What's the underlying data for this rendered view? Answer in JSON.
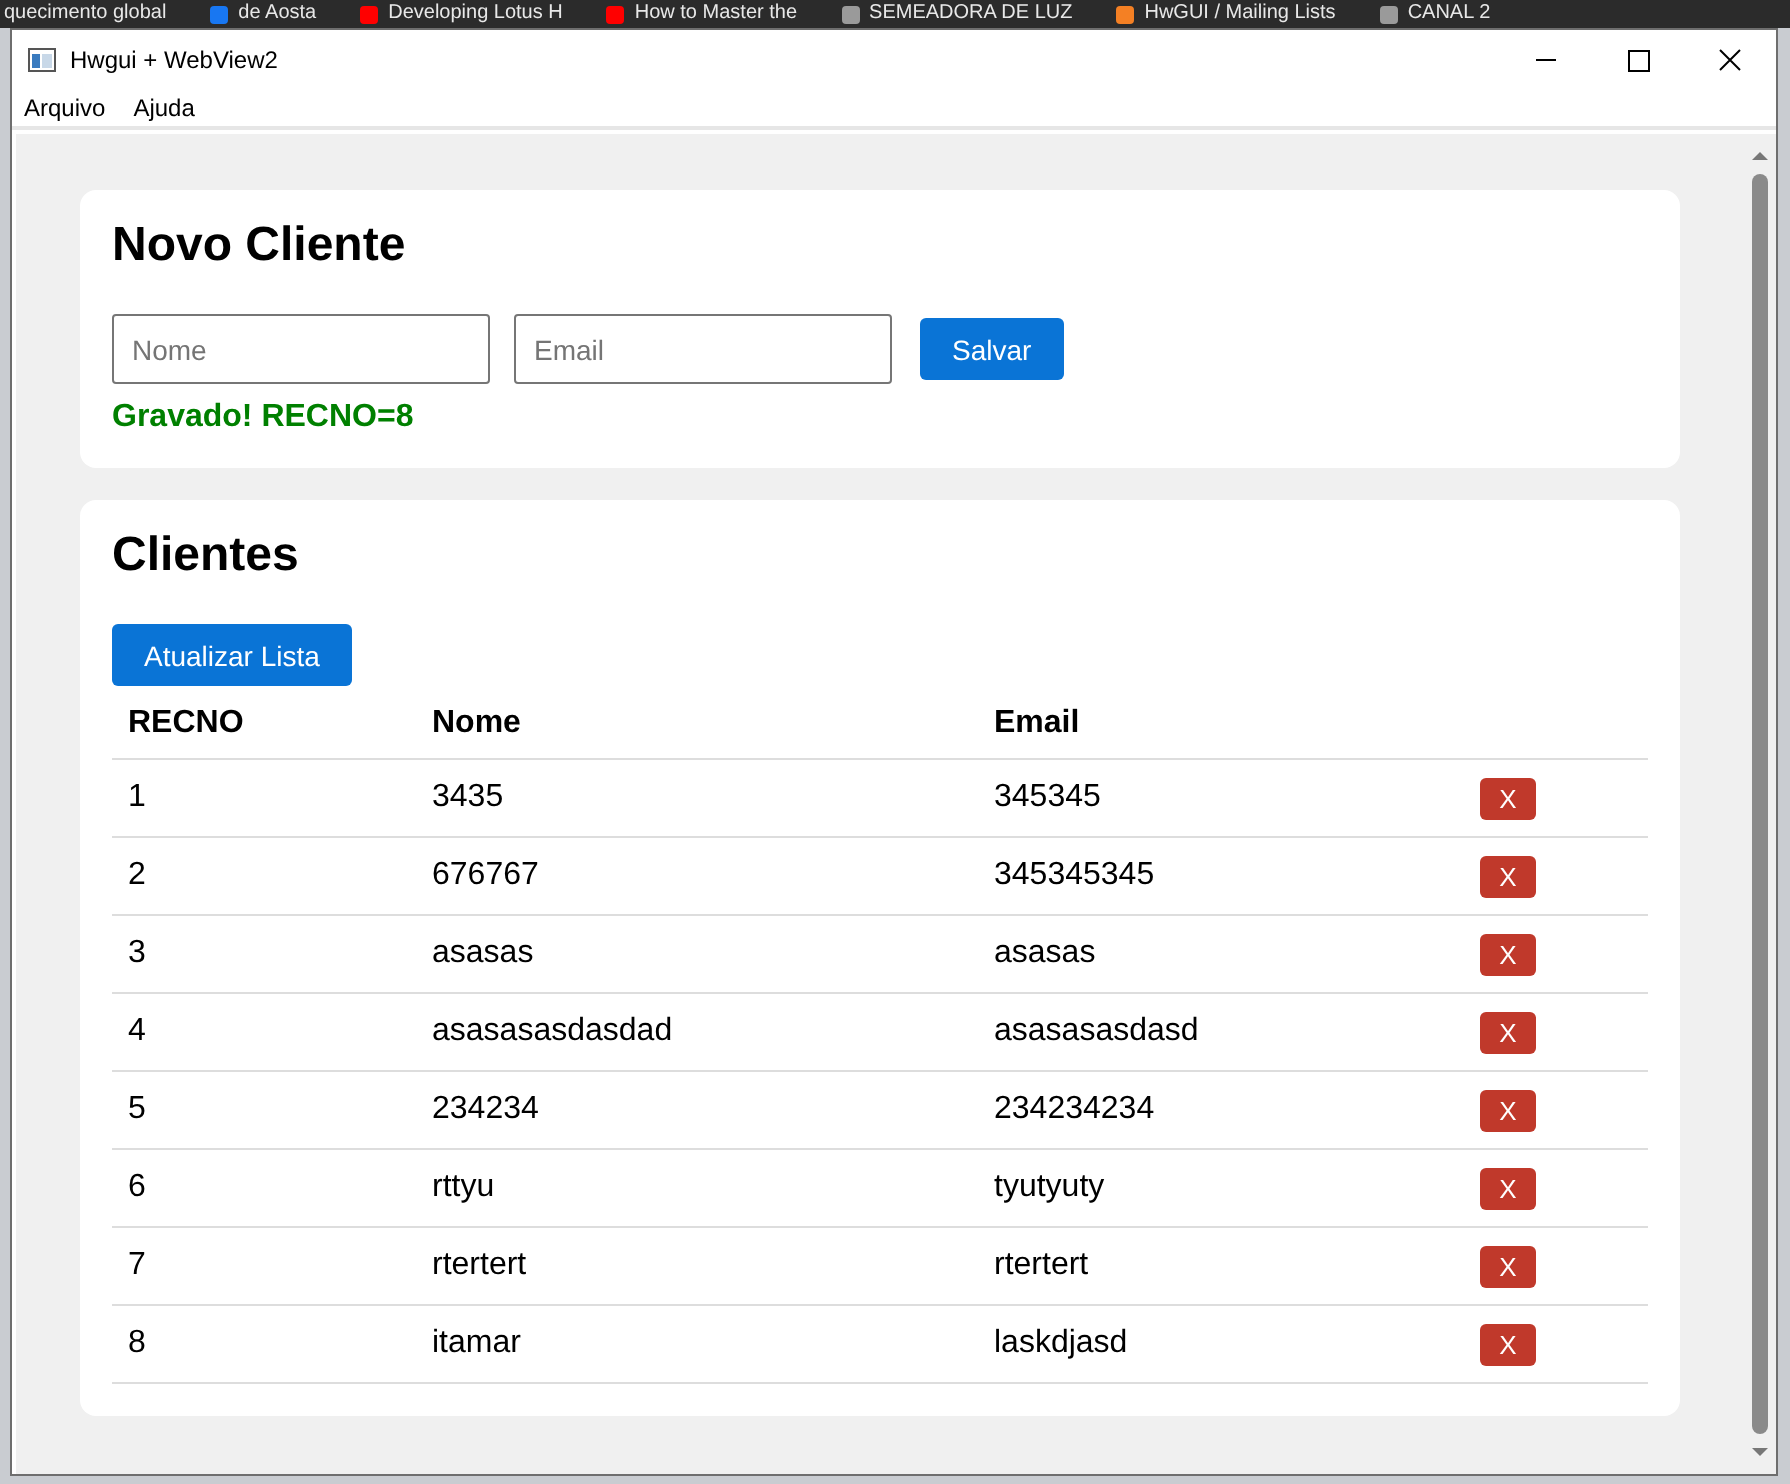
{
  "bookmarks_bar": [
    {
      "label": "quecimento global"
    },
    {
      "label": "de Aosta",
      "color": "#1877f2"
    },
    {
      "label": "Developing Lotus H",
      "color": "#ff0000"
    },
    {
      "label": "How to Master the",
      "color": "#ff0000"
    },
    {
      "label": "SEMEADORA DE LUZ",
      "color": "#9a9a9a"
    },
    {
      "label": "HwGUI / Mailing Lists",
      "color": "#f48024"
    },
    {
      "label": "CANAL 2",
      "color": "#9a9a9a"
    }
  ],
  "window": {
    "title": "Hwgui + WebView2"
  },
  "menu": [
    "Arquivo",
    "Ajuda"
  ],
  "form": {
    "title": "Novo Cliente",
    "name_placeholder": "Nome",
    "email_placeholder": "Email",
    "save_button": "Salvar",
    "message": "Gravado! RECNO=8"
  },
  "clients": {
    "title": "Clientes",
    "refresh_button": "Atualizar Lista",
    "columns": [
      "RECNO",
      "Nome",
      "Email"
    ],
    "rows": [
      {
        "recno": "1",
        "name": "3435",
        "email": "345345",
        "delete": "X"
      },
      {
        "recno": "2",
        "name": "676767",
        "email": "345345345",
        "delete": "X"
      },
      {
        "recno": "3",
        "name": "asasas",
        "email": "asasas",
        "delete": "X"
      },
      {
        "recno": "4",
        "name": "asasasasdasdad",
        "email": "asasasasdasd",
        "delete": "X"
      },
      {
        "recno": "5",
        "name": "234234",
        "email": "234234234",
        "delete": "X"
      },
      {
        "recno": "6",
        "name": "rttyu",
        "email": "tyutyuty",
        "delete": "X"
      },
      {
        "recno": "7",
        "name": "rtertert",
        "email": "rtertert",
        "delete": "X"
      },
      {
        "recno": "8",
        "name": "itamar",
        "email": "laskdjasd",
        "delete": "X"
      }
    ]
  }
}
